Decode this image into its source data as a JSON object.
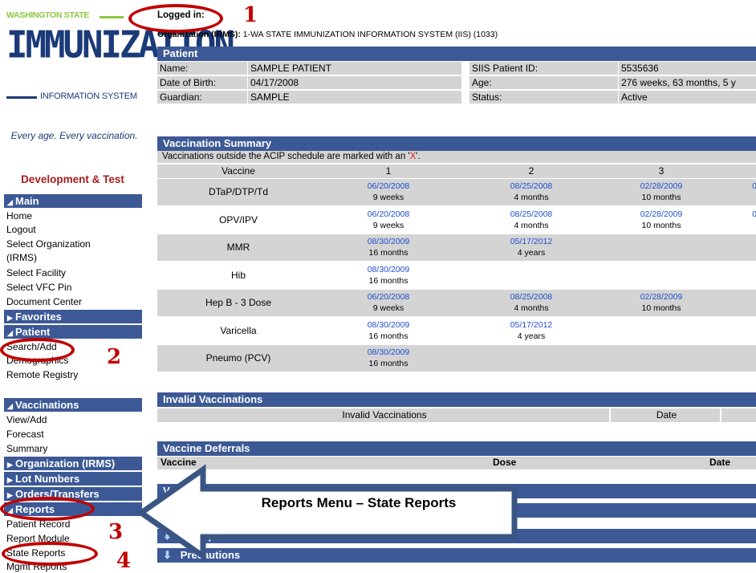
{
  "logo": {
    "top": "WASHINGTON STATE",
    "main": "IMMUNIZATION",
    "bottom": "INFORMATION SYSTEM"
  },
  "tagline": "Every age. Every vaccination.",
  "environment": "Development & Test",
  "nav": {
    "main": {
      "label": "Main",
      "items": [
        "Home",
        "Logout",
        "Select Organization",
        "(IRMS)",
        "Select Facility",
        "Select VFC Pin",
        "Document Center"
      ]
    },
    "favorites": "Favorites",
    "patient": {
      "label": "Patient",
      "items": [
        "Search/Add",
        "Demographics",
        "Remote Registry"
      ]
    },
    "vaccinations": {
      "label": "Vaccinations",
      "items": [
        "View/Add",
        "Forecast",
        "Summary"
      ]
    },
    "organization": "Organization (IRMS)",
    "lot_numbers": "Lot Numbers",
    "orders": "Orders/Transfers",
    "reports": {
      "label": "Reports",
      "items": [
        "Patient Record",
        "Report Module",
        "State Reports",
        "Mgmt Reports"
      ]
    }
  },
  "header": {
    "logged_in": "Logged in:",
    "org_label": "Organization (IRMS):",
    "org_value": "1-WA STATE IMMUNIZATION INFORMATION SYSTEM (IIS) (1033)"
  },
  "patient": {
    "title": "Patient",
    "name_label": "Name:",
    "name": "SAMPLE PATIENT",
    "dob_label": "Date of Birth:",
    "dob": "04/17/2008",
    "guardian_label": "Guardian:",
    "guardian": "SAMPLE",
    "siis_label": "SIIS Patient ID:",
    "siis": "5535636",
    "age_label": "Age:",
    "age": "276 weeks, 63 months, 5 y",
    "status_label": "Status:",
    "status": "Active"
  },
  "summary": {
    "title": "Vaccination Summary",
    "note_prefix": "Vaccinations outside the ACIP schedule are marked with an '",
    "note_x": "X",
    "note_suffix": "'.",
    "col_vaccine": "Vaccine",
    "cols": [
      "1",
      "2",
      "3"
    ],
    "rows": [
      {
        "name": "DTaP/DTP/Td",
        "doses": [
          [
            "06/20/2008",
            "9 weeks"
          ],
          [
            "08/25/2008",
            "4 months"
          ],
          [
            "02/28/2009",
            "10 months"
          ]
        ],
        "extra": "0"
      },
      {
        "name": "OPV/IPV",
        "doses": [
          [
            "06/20/2008",
            "9 weeks"
          ],
          [
            "08/25/2008",
            "4 months"
          ],
          [
            "02/28/2009",
            "10 months"
          ]
        ],
        "extra": "0"
      },
      {
        "name": "MMR",
        "doses": [
          [
            "08/30/2009",
            "16 months"
          ],
          [
            "05/17/2012",
            "4 years"
          ]
        ],
        "extra": ""
      },
      {
        "name": "Hib",
        "doses": [
          [
            "08/30/2009",
            "16 months"
          ]
        ],
        "extra": ""
      },
      {
        "name": "Hep B - 3 Dose",
        "doses": [
          [
            "06/20/2008",
            "9 weeks"
          ],
          [
            "08/25/2008",
            "4 months"
          ],
          [
            "02/28/2009",
            "10 months"
          ]
        ],
        "extra": ""
      },
      {
        "name": "Varicella",
        "doses": [
          [
            "08/30/2009",
            "16 months"
          ],
          [
            "05/17/2012",
            "4 years"
          ]
        ],
        "extra": ""
      },
      {
        "name": "Pneumo (PCV)",
        "doses": [
          [
            "08/30/2009",
            "16 months"
          ]
        ],
        "extra": ""
      }
    ]
  },
  "invalid": {
    "title": "Invalid Vaccinations",
    "col1": "Invalid Vaccinations",
    "col2": "Date"
  },
  "deferrals": {
    "title": "Vaccine Deferrals",
    "col1": "Vaccine",
    "col2": "Dose",
    "col3": "Date"
  },
  "collapsed": {
    "bar1": "V",
    "exemptions": "Exemptions",
    "precautions": "Precautions"
  },
  "annotations": {
    "n1": "1",
    "n2": "2",
    "n3": "3",
    "n4": "4",
    "callout": "Reports Menu – State Reports",
    "red": "#c00000"
  }
}
